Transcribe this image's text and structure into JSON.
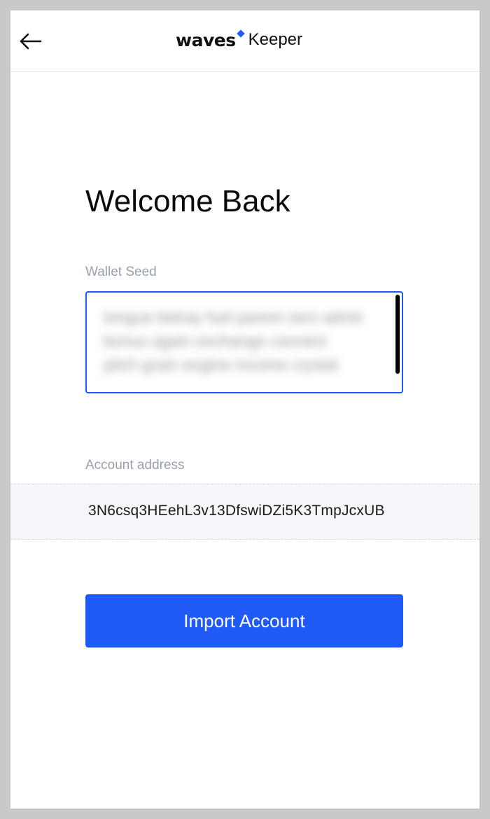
{
  "header": {
    "back_icon": "arrow-left-icon",
    "logo_primary": "waves",
    "logo_secondary": "Keeper",
    "accent_color": "#1f5af6"
  },
  "main": {
    "title": "Welcome Back",
    "seed": {
      "label": "Wallet Seed",
      "value": "tongue betray fuel parent zero admit bonus again exchange connect pitch grain engine income crystal",
      "obscured": true
    },
    "address": {
      "label": "Account address",
      "value": "3N6csq3HEehL3v13DfswiDZi5K3TmpJcxUB"
    },
    "import_button": {
      "label": "Import Account",
      "color": "#1f5af6"
    }
  }
}
